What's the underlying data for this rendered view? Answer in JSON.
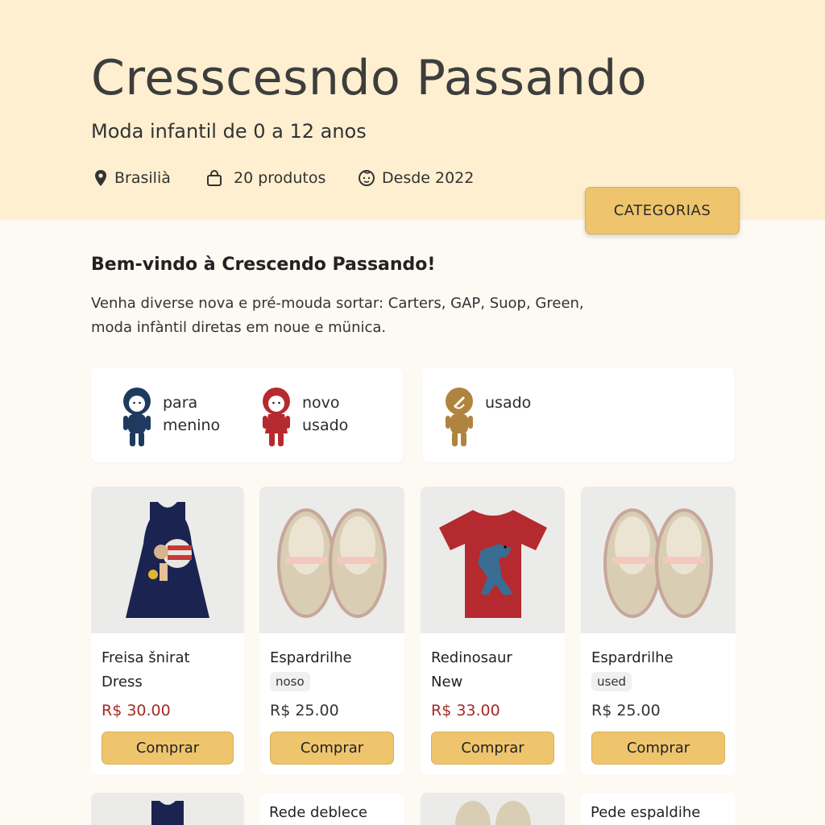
{
  "store": {
    "title": "Cresscesndo Passando",
    "subtitle": "Moda infantil de 0 a 12 anos",
    "location": "Brasilià",
    "products_count": "20 produtos",
    "since": "Desde 2022",
    "categories_button": "CATEGORIAS"
  },
  "welcome": {
    "heading": "Bem-vindo à Crescendo Passando!",
    "line1": "Venha diverse nova e pré-mouda sortar: Carters, GAP, Suop, Green,",
    "line2": "moda infàntil diretas em noue e münica."
  },
  "filters": [
    {
      "line1": "para",
      "line2": "menino",
      "icon": "boy-figure-icon",
      "color": "#1f3a5f"
    },
    {
      "line1": "novo",
      "line2": "usado",
      "icon": "girl-figure-icon",
      "color": "#b52a2e"
    },
    {
      "line1": "usado",
      "line2": "",
      "icon": "used-figure-icon",
      "color": "#b0843f"
    }
  ],
  "products": [
    {
      "name": "Freisa šnirat",
      "note": "Dress",
      "badge": "",
      "price": "R$ 30.00",
      "price_style": "sale",
      "button": "Comprar",
      "image": "navy-dress"
    },
    {
      "name": "Espardrilhe",
      "note": "",
      "badge": "noso",
      "price": "R$ 25.00",
      "price_style": "regular",
      "button": "Comprar",
      "image": "espadrille-shoes"
    },
    {
      "name": "Redinosaur",
      "note": "New",
      "badge": "",
      "price": "R$ 33.00",
      "price_style": "sale",
      "button": "Comprar",
      "image": "red-dinosaur-tshirt"
    },
    {
      "name": "Espardrilhe",
      "note": "",
      "badge": "used",
      "price": "R$ 25.00",
      "price_style": "regular",
      "button": "Comprar",
      "image": "espadrille-shoes"
    }
  ],
  "next_row": [
    {
      "name": "",
      "image": "navy-dress"
    },
    {
      "name": "Rede deblece",
      "image": ""
    },
    {
      "name": "",
      "image": "espadrille-shoes"
    },
    {
      "name": "Pede espaldihe",
      "image": ""
    }
  ],
  "colors": {
    "hero_bg": "#fdefcf",
    "accent_button": "#eec56d",
    "sale_price": "#a32a23"
  }
}
